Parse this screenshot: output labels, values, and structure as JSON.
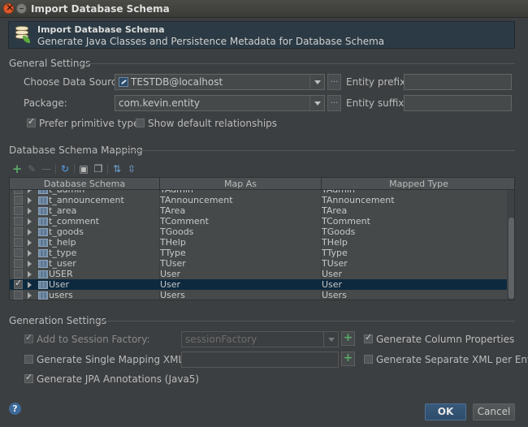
{
  "window": {
    "title": "Import Database Schema"
  },
  "header": {
    "title": "Import Database Schema",
    "subtitle": "Generate Java Classes and Persistence Metadata for Database Schema"
  },
  "general": {
    "section_label": "General Settings",
    "datasource_label": "Choose Data Source:",
    "datasource_value": "TESTDB@localhost",
    "package_label": "Package:",
    "package_value": "com.kevin.entity",
    "dots": "...",
    "entity_prefix_label": "Entity prefix:",
    "entity_suffix_label": "Entity suffix:",
    "prefer_primitive_label": "Prefer primitive types",
    "prefer_primitive_checked": true,
    "show_default_rel_label": "Show default relationships",
    "show_default_rel_checked": false
  },
  "mapping": {
    "section_label": "Database Schema Mapping",
    "toolbar_icons": [
      "add-icon",
      "edit-icon",
      "remove-icon",
      "refresh-icon",
      "select-all-icon",
      "unselect-all-icon",
      "expand-all-icon",
      "collapse-all-icon"
    ],
    "columns": [
      "Database Schema",
      "Map As",
      "Mapped Type"
    ],
    "partial_row": {
      "schema": "t_admin",
      "map_as": "TAdmin",
      "mapped_type": "TAdmin"
    },
    "rows": [
      {
        "schema": "t_announcement",
        "map_as": "TAnnouncement",
        "mapped_type": "TAnnouncement",
        "checked": false
      },
      {
        "schema": "t_area",
        "map_as": "TArea",
        "mapped_type": "TArea",
        "checked": false
      },
      {
        "schema": "t_comment",
        "map_as": "TComment",
        "mapped_type": "TComment",
        "checked": false
      },
      {
        "schema": "t_goods",
        "map_as": "TGoods",
        "mapped_type": "TGoods",
        "checked": false
      },
      {
        "schema": "t_help",
        "map_as": "THelp",
        "mapped_type": "THelp",
        "checked": false
      },
      {
        "schema": "t_type",
        "map_as": "TType",
        "mapped_type": "TType",
        "checked": false
      },
      {
        "schema": "t_user",
        "map_as": "TUser",
        "mapped_type": "TUser",
        "checked": false
      },
      {
        "schema": "USER",
        "map_as": "User",
        "mapped_type": "User",
        "checked": false
      },
      {
        "schema": "User",
        "map_as": "User",
        "mapped_type": "User",
        "checked": true,
        "selected": true
      },
      {
        "schema": "users",
        "map_as": "Users",
        "mapped_type": "Users",
        "checked": false
      }
    ]
  },
  "generation": {
    "section_label": "Generation Settings",
    "session_factory_label": "Add to Session Factory:",
    "session_factory_checked": true,
    "session_factory_value": "sessionFactory",
    "single_mapping_label": "Generate Single Mapping XML:",
    "single_mapping_checked": false,
    "jpa_label": "Generate JPA Annotations (Java5)",
    "jpa_checked": true,
    "column_props_label": "Generate Column Properties",
    "column_props_checked": true,
    "separate_xml_label": "Generate Separate XML per Enti...",
    "separate_xml_checked": false,
    "plus": "+"
  },
  "footer": {
    "help": "?",
    "ok_label": "OK",
    "cancel_label": "Cancel"
  },
  "colors": {
    "background": "#3c3f41",
    "header_panel": "#2b3a44",
    "selection": "#0d293e",
    "add_green": "#59a869",
    "ok_button": "#38597a"
  }
}
